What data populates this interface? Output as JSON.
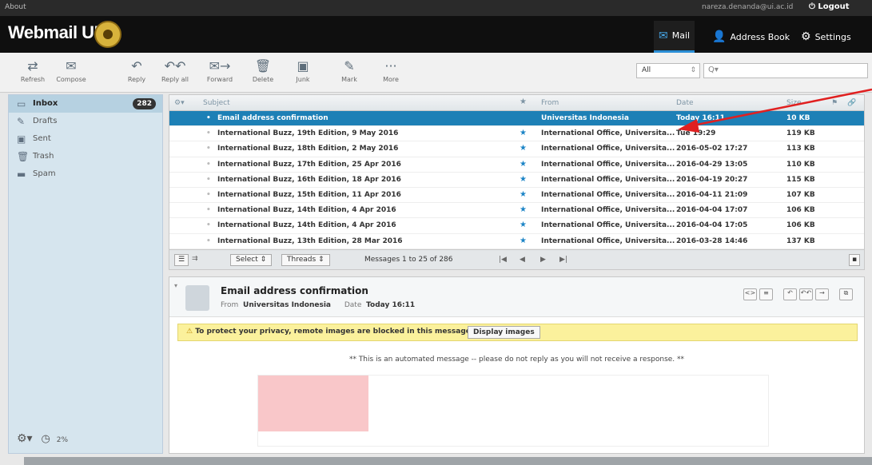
{
  "topbar": {
    "about": "About",
    "user": "nareza.denanda@ui.ac.id",
    "logout": "Logout"
  },
  "app": {
    "title": "Webmail UI"
  },
  "nav": {
    "mail": "Mail",
    "address_book": "Address Book",
    "settings": "Settings"
  },
  "toolbar": {
    "refresh": "Refresh",
    "compose": "Compose",
    "reply": "Reply",
    "reply_all": "Reply all",
    "forward": "Forward",
    "delete": "Delete",
    "junk": "Junk",
    "mark": "Mark",
    "more": "More"
  },
  "filter": {
    "value": "All"
  },
  "search": {
    "placeholder": "Q▾"
  },
  "folders": [
    {
      "label": "Inbox",
      "count": "282"
    },
    {
      "label": "Drafts"
    },
    {
      "label": "Sent"
    },
    {
      "label": "Trash"
    },
    {
      "label": "Spam"
    }
  ],
  "sidebar_footer": {
    "quota": "2%"
  },
  "list": {
    "headers": {
      "subject": "Subject",
      "from": "From",
      "date": "Date",
      "size": "Size"
    },
    "rows": [
      {
        "subject": "Email address confirmation",
        "from": "Universitas Indonesia",
        "date": "Today 16:11",
        "size": "10 KB"
      },
      {
        "subject": "International Buzz, 19th Edition, 9 May 2016",
        "from": "International Office, Universita...",
        "date": "Tue 19:29",
        "size": "119 KB"
      },
      {
        "subject": "International Buzz, 18th Edition, 2 May 2016",
        "from": "International Office, Universita...",
        "date": "2016-05-02 17:27",
        "size": "113 KB"
      },
      {
        "subject": "International Buzz, 17th Edition, 25 Apr 2016",
        "from": "International Office, Universita...",
        "date": "2016-04-29 13:05",
        "size": "110 KB"
      },
      {
        "subject": "International Buzz, 16th Edition, 18 Apr 2016",
        "from": "International Office, Universita...",
        "date": "2016-04-19 20:27",
        "size": "115 KB"
      },
      {
        "subject": "International Buzz, 15th Edition, 11 Apr 2016",
        "from": "International Office, Universita...",
        "date": "2016-04-11 21:09",
        "size": "107 KB"
      },
      {
        "subject": "International Buzz, 14th Edition, 4 Apr 2016",
        "from": "International Office, Universita...",
        "date": "2016-04-04 17:07",
        "size": "106 KB"
      },
      {
        "subject": "International Buzz, 14th Edition, 4 Apr 2016",
        "from": "International Office, Universita...",
        "date": "2016-04-04 17:05",
        "size": "106 KB"
      },
      {
        "subject": "International Buzz, 13th Edition, 28 Mar 2016",
        "from": "International Office, Universita...",
        "date": "2016-03-28 14:46",
        "size": "137 KB"
      }
    ],
    "footer": {
      "select": "Select",
      "threads": "Threads",
      "count": "Messages 1 to 25 of 286"
    }
  },
  "preview": {
    "subject": "Email address confirmation",
    "from_label": "From",
    "from": "Universitas Indonesia",
    "date_label": "Date",
    "date": "Today 16:11",
    "warning": "To protect your privacy, remote images are blocked in this message.",
    "display_images": "Display images",
    "automated": "** This is an automated message -- please do not reply as you will not receive a response. **"
  },
  "colors": {
    "selected_row": "#1d80b6",
    "warning_bg": "#fbf19c",
    "sidebar_bg": "#d6e5ee",
    "annotation_arrow": "#e02020"
  }
}
